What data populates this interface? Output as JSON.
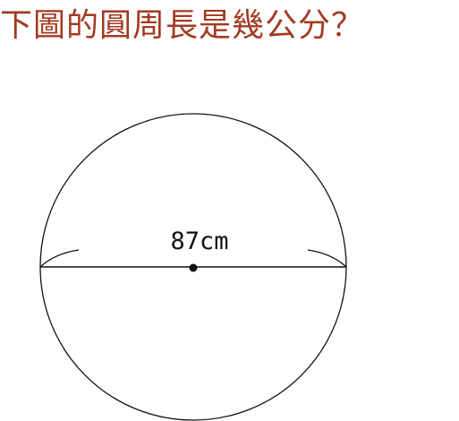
{
  "question": {
    "text": "下圖的圓周長是幾公分？",
    "color": "#a23a22"
  },
  "figure": {
    "shape": "circle",
    "line_color": "#111111",
    "diameter_label": "87cm",
    "has_center_point": true,
    "has_dimension_arcs": true
  }
}
